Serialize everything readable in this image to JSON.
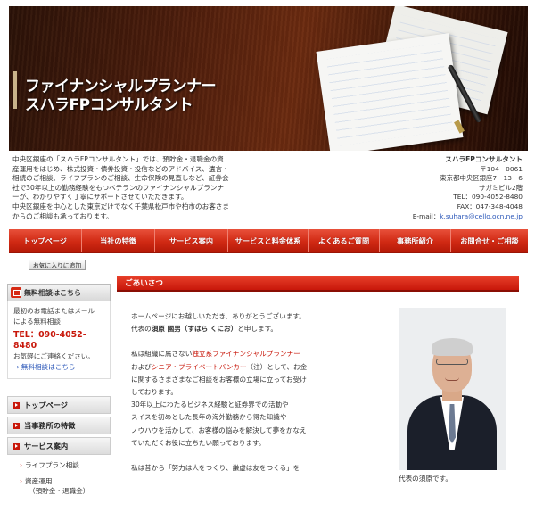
{
  "hero": {
    "title_line1": "ファイナンシャルプランナー",
    "title_line2": "スハラFPコンサルタント"
  },
  "intro": {
    "lines": [
      "中央区銀座の「スハラFPコンサルタント」では、預貯金・退職金の資",
      "産運用をはじめ、株式投資・債券投資・投信などのアドバイス、遺言・",
      "相続のご相談、ライフプランのご相談、生命保険の見直しなど、証券会",
      "社で30年以上の勤務経験をもつベテランのファイナンシャルプランナ",
      "ーが、わかりやすく丁寧にサポートさせていただきます。",
      "中央区銀座を中心とした東京だけでなく千葉県松戸市や柏市のお客さま",
      "からのご相談も承っております。"
    ]
  },
  "contact": {
    "name": "スハラFPコンサルタント",
    "postal": "〒104－0061",
    "address": "東京都中央区銀座7－13－6",
    "building": "サガミビル2階",
    "tel": "TEL：090-4052-8480",
    "fax": "FAX：047-348-4048",
    "email_label": "E-mail：",
    "email": "k.suhara@cello.ocn.ne.jp"
  },
  "nav": {
    "items": [
      {
        "label": "トップページ"
      },
      {
        "label": "当社の特徴"
      },
      {
        "label": "サービス案内"
      },
      {
        "label": "サービスと料金体系"
      },
      {
        "label": "よくあるご質問"
      },
      {
        "label": "事務所紹介"
      },
      {
        "label": "お問合せ・ご相談"
      }
    ]
  },
  "sidebar": {
    "favorite_button": "お気に入りに追加",
    "consult_head": "無料相談はこちら",
    "consult_text1": "最初のお電話またはメール",
    "consult_text2": "による無料相談",
    "tel": "TEL：090-4052-8480",
    "contact_text": "お気軽にご連絡ください。",
    "consult_link": "→ 無料相談はこちら",
    "items": [
      {
        "label": "トップページ"
      },
      {
        "label": "当事務所の特徴"
      },
      {
        "label": "サービス案内"
      }
    ],
    "sub_items": [
      {
        "label": "ライフプラン相談"
      },
      {
        "label": "資産運用"
      },
      {
        "label": "（預貯金・退職金）"
      }
    ]
  },
  "main": {
    "section_title": "ごあいさつ",
    "p1": "ホームページにお越しいただき、ありがとうございます。",
    "p2_a": "代表の",
    "p2_name": "須原 國男（すはら くにお）",
    "p2_b": "と申します。",
    "p3_a": "私は組織に属さない",
    "p3_hl": "独立系ファイナンシャルプランナー",
    "p4_a": "および",
    "p4_hl": "シニア・プライベートバンカー",
    "p4_b": "（注）として、お金",
    "p5": "に関するさまざまなご相談をお客様の立場に立ってお受け",
    "p6": "しております。",
    "p7": "30年以上にわたるビジネス経験と証券界での活動や",
    "p8": "スイスを初めとした長年の海外勤務から得た知識や",
    "p9": "ノウハウを活かして、お客様の悩みを解決して夢をかなえ",
    "p10": "ていただくお役に立ちたい願っております。",
    "p11": "私は昔から「努力は人をつくり、謙虚は友をつくる」を",
    "photo_caption": "代表の須原です。"
  },
  "colors": {
    "accent_red": "#c8170a",
    "link_blue": "#2a56b8"
  }
}
